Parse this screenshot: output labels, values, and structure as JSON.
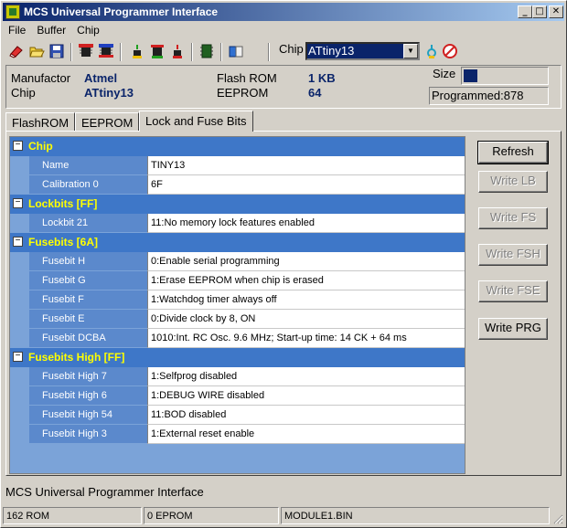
{
  "window": {
    "title": "MCS Universal Programmer Interface"
  },
  "menu": [
    "File",
    "Buffer",
    "Chip"
  ],
  "toolbar": {
    "chip_label": "Chip",
    "chip_value": "ATtiny13",
    "icons": [
      "erase-icon",
      "open-icon",
      "save-icon",
      "read-icon",
      "verify-icon",
      "program-icon",
      "blank-check-icon",
      "write-icon",
      "chip-icon",
      "config-icon",
      "power-icon",
      "stop-icon"
    ]
  },
  "info": {
    "manufactor_label": "Manufactor",
    "manufactor_value": "Atmel",
    "chip_label": "Chip",
    "chip_value": "ATtiny13",
    "flash_label": "Flash ROM",
    "flash_value": "1 KB",
    "eeprom_label": "EEPROM",
    "eeprom_value": "64",
    "size_label": "Size",
    "size_fill_fraction": 0.16,
    "programmed_text": "Programmed:878"
  },
  "tabs": [
    "FlashROM",
    "EEPROM",
    "Lock and Fuse Bits"
  ],
  "groups": [
    {
      "name": "Chip",
      "items": [
        {
          "name": "Name",
          "value": "TINY13"
        },
        {
          "name": "Calibration 0",
          "value": "6F"
        }
      ]
    },
    {
      "name": "Lockbits [FF]",
      "items": [
        {
          "name": "Lockbit 21",
          "value": "11:No memory lock features enabled"
        }
      ]
    },
    {
      "name": "Fusebits [6A]",
      "items": [
        {
          "name": "Fusebit H",
          "value": "0:Enable serial programming"
        },
        {
          "name": "Fusebit G",
          "value": "1:Erase EEPROM when chip is erased"
        },
        {
          "name": "Fusebit F",
          "value": "1:Watchdog timer always off"
        },
        {
          "name": "Fusebit E",
          "value": "0:Divide clock by 8, ON"
        },
        {
          "name": "Fusebit DCBA",
          "value": "1010:Int. RC Osc. 9.6 MHz; Start-up time: 14 CK + 64 ms"
        }
      ]
    },
    {
      "name": "Fusebits High [FF]",
      "items": [
        {
          "name": "Fusebit High 7",
          "value": "1:Selfprog disabled"
        },
        {
          "name": "Fusebit High 6",
          "value": "1:DEBUG WIRE disabled"
        },
        {
          "name": "Fusebit High 54",
          "value": "11:BOD disabled"
        },
        {
          "name": "Fusebit High 3",
          "value": "1:External reset enable"
        }
      ]
    }
  ],
  "buttons": {
    "refresh": "Refresh",
    "write_lb": "Write LB",
    "write_fs": "Write FS",
    "write_fsh": "Write FSH",
    "write_fse": "Write FSE",
    "write_prg": "Write PRG"
  },
  "status_message": "MCS Universal Programmer Interface",
  "statusbar": [
    "162 ROM",
    "0 EPROM",
    "MODULE1.BIN"
  ],
  "colors": {
    "title_bar": "#0a246a",
    "group_row": "#3e77c8",
    "group_text": "#ffff00",
    "name_cell": "#5b89cc",
    "grid_bg": "#7ba3d8"
  }
}
